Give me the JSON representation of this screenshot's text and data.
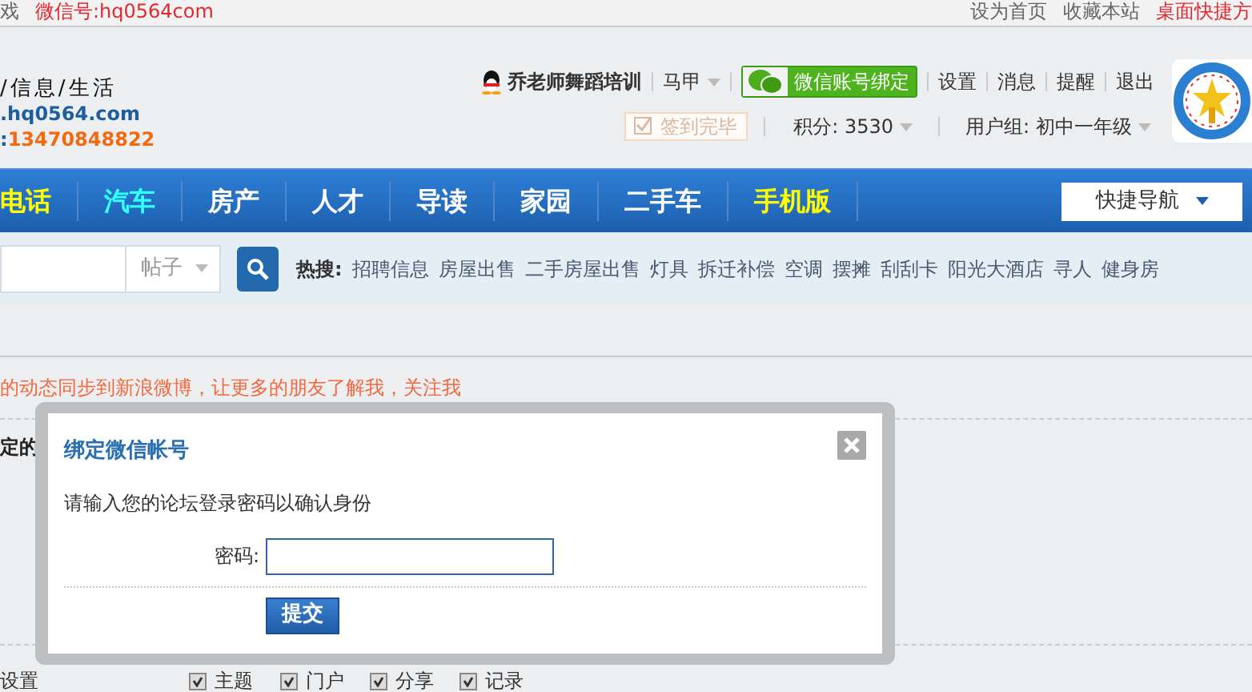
{
  "top_bar": {
    "left": [
      {
        "text": "戏",
        "kind": "plain"
      },
      {
        "text": "微信号:hq0564com",
        "kind": "highlight"
      }
    ],
    "right": [
      {
        "text": "设为首页",
        "kind": "plain"
      },
      {
        "text": "收藏本站",
        "kind": "plain"
      },
      {
        "text": "桌面快捷方",
        "kind": "highlight"
      }
    ]
  },
  "site": {
    "slogan": "/信息/生活",
    "url": ".hq0564.com",
    "phone_prefix": ":",
    "phone": "13470848822"
  },
  "user": {
    "name": "乔老师舞蹈培训",
    "vest": "马甲",
    "wechat_button": "微信账号绑定",
    "links": [
      "设置",
      "消息",
      "提醒",
      "退出"
    ],
    "checkin": {
      "label": "签到完毕",
      "disabled": true
    },
    "points": "积分: 3530",
    "group": "用户组: 初中一年级"
  },
  "nav": {
    "items": [
      {
        "label": "电话",
        "color": "#ffff00"
      },
      {
        "label": "汽车",
        "color": "#33ffff"
      },
      {
        "label": "房产",
        "color": "#ffffff"
      },
      {
        "label": "人才",
        "color": "#ffffff"
      },
      {
        "label": "导读",
        "color": "#ffffff"
      },
      {
        "label": "家园",
        "color": "#ffffff"
      },
      {
        "label": "二手车",
        "color": "#ffffff"
      },
      {
        "label": "手机版",
        "color": "#ffff00"
      }
    ],
    "quick_nav": "快捷导航"
  },
  "search": {
    "type": "帖子",
    "hot_label": "热搜:",
    "hot": [
      "招聘信息",
      "房屋出售",
      "二手房屋出售",
      "灯具",
      "拆迁补偿",
      "空调",
      "摆摊",
      "刮刮卡",
      "阳光大酒店",
      "寻人",
      "健身房"
    ]
  },
  "notice": "的动态同步到新浪微博，让更多的朋友了解我，关注我",
  "background": {
    "heading": "定的",
    "settings_label": "设置",
    "options": [
      {
        "label": "主题",
        "checked": true
      },
      {
        "label": "门户",
        "checked": true
      },
      {
        "label": "分享",
        "checked": true
      },
      {
        "label": "记录",
        "checked": true
      }
    ]
  },
  "dialog": {
    "title": "绑定微信帐号",
    "prompt": "请输入您的论坛登录密码以确认身份",
    "password_label": "密码:",
    "submit": "提交"
  }
}
